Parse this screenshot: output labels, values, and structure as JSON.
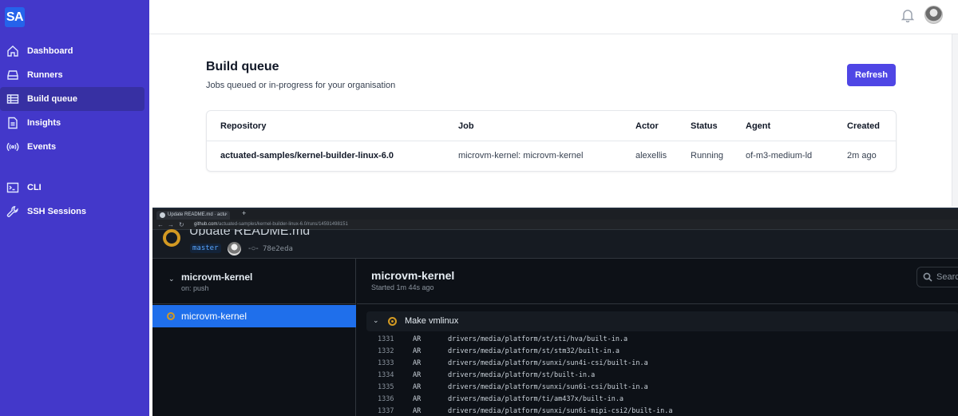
{
  "app": {
    "logo": "SA"
  },
  "sidebar": {
    "items": [
      {
        "label": "Dashboard",
        "icon": "home-icon"
      },
      {
        "label": "Runners",
        "icon": "server-icon"
      },
      {
        "label": "Build queue",
        "icon": "table-icon",
        "active": true
      },
      {
        "label": "Insights",
        "icon": "document-icon"
      },
      {
        "label": "Events",
        "icon": "signal-icon"
      },
      {
        "label": "CLI",
        "icon": "terminal-icon"
      },
      {
        "label": "SSH Sessions",
        "icon": "wrench-icon"
      }
    ]
  },
  "topbar": {
    "bell_icon": "bell-icon",
    "avatar": "user-avatar"
  },
  "main": {
    "title": "Build queue",
    "subtitle": "Jobs queued or in-progress for your organisation",
    "refresh_label": "Refresh",
    "table": {
      "columns": [
        "Repository",
        "Job",
        "Actor",
        "Status",
        "Agent",
        "Created"
      ],
      "rows": [
        [
          "actuated-samples/kernel-builder-linux-6.0",
          "microvm-kernel: microvm-kernel",
          "alexellis",
          "Running",
          "of-m3-medium-ld",
          "2m ago"
        ]
      ]
    }
  },
  "github": {
    "tab_title": "Update README.md · actu",
    "tab_close": "×",
    "new_tab": "+",
    "url_host": "github.com",
    "url_path": "/actuated-samples/kernel-builder-linux-6.0/runs/14591498151",
    "commit_title": "Update README.md",
    "branch": "master",
    "sha": "78e2eda",
    "workflow_name": "microvm-kernel",
    "workflow_trigger": "on: push",
    "job_name": "microvm-kernel",
    "job_title": "microvm-kernel",
    "job_started": "Started 1m 44s ago",
    "search_placeholder": "Searc",
    "step_name": "Make vmlinux",
    "log": [
      {
        "n": "1331",
        "cmd": "AR",
        "path": "drivers/media/platform/st/sti/hva/built-in.a"
      },
      {
        "n": "1332",
        "cmd": "AR",
        "path": "drivers/media/platform/st/stm32/built-in.a"
      },
      {
        "n": "1333",
        "cmd": "AR",
        "path": "drivers/media/platform/sunxi/sun4i-csi/built-in.a"
      },
      {
        "n": "1334",
        "cmd": "AR",
        "path": "drivers/media/platform/st/built-in.a"
      },
      {
        "n": "1335",
        "cmd": "AR",
        "path": "drivers/media/platform/sunxi/sun6i-csi/built-in.a"
      },
      {
        "n": "1336",
        "cmd": "AR",
        "path": "drivers/media/platform/ti/am437x/built-in.a"
      },
      {
        "n": "1337",
        "cmd": "AR",
        "path": "drivers/media/platform/sunxi/sun6i-mipi-csi2/built-in.a"
      }
    ]
  }
}
